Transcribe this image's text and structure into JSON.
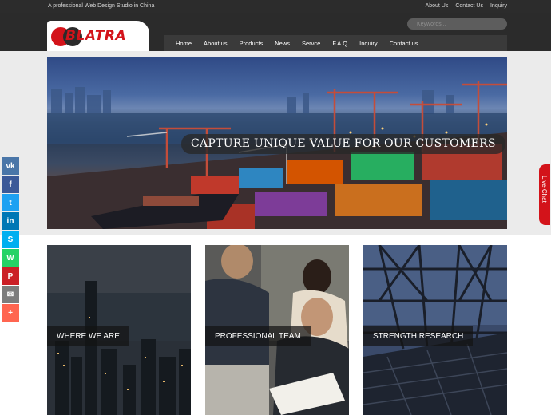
{
  "topbar": {
    "tagline": "A professional Web Design Studio in China",
    "links": [
      "About Us",
      "Contact Us",
      "Inquiry"
    ]
  },
  "header": {
    "logo_text": "BLATRA",
    "search_placeholder": "Keywords...",
    "nav": [
      "Home",
      "About us",
      "Products",
      "News",
      "Servce",
      "F.A.Q",
      "Inquiry",
      "Contact us"
    ]
  },
  "hero": {
    "caption": "CAPTURE UNIQUE VALUE FOR OUR CUSTOMERS"
  },
  "cards": [
    {
      "label": "WHERE WE ARE"
    },
    {
      "label": "PROFESSIONAL TEAM"
    },
    {
      "label": "STRENGTH RESEARCH"
    }
  ],
  "social": [
    {
      "icon": "vk-icon",
      "glyph": "vk",
      "color": "#4a76a8"
    },
    {
      "icon": "facebook-icon",
      "glyph": "f",
      "color": "#3b5998"
    },
    {
      "icon": "twitter-icon",
      "glyph": "t",
      "color": "#1da1f2"
    },
    {
      "icon": "linkedin-icon",
      "glyph": "in",
      "color": "#0077b5"
    },
    {
      "icon": "skype-icon",
      "glyph": "S",
      "color": "#00aff0"
    },
    {
      "icon": "whatsapp-icon",
      "glyph": "W",
      "color": "#25d366"
    },
    {
      "icon": "pinterest-icon",
      "glyph": "P",
      "color": "#cb2027"
    },
    {
      "icon": "email-icon",
      "glyph": "✉",
      "color": "#7d7d7d"
    },
    {
      "icon": "plus-icon",
      "glyph": "+",
      "color": "#ff6550"
    }
  ],
  "livechat": {
    "label": "Live Chat"
  },
  "colors": {
    "brand_red": "#d3131a",
    "header_dark": "#2b2b2b"
  }
}
